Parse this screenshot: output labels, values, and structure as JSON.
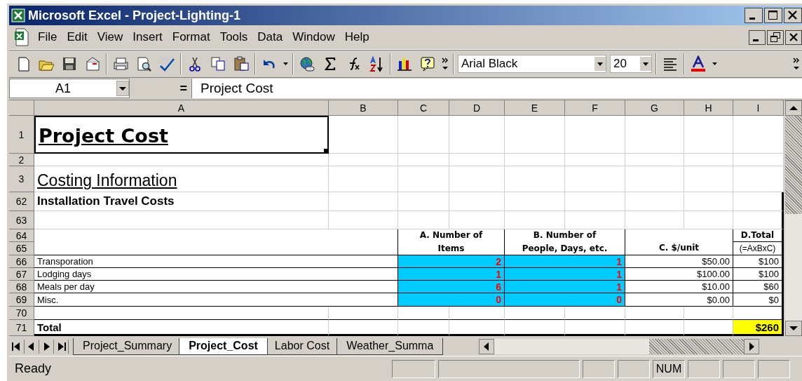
{
  "window": {
    "title": "Microsoft Excel - Project-Lighting-1"
  },
  "menu": [
    "File",
    "Edit",
    "View",
    "Insert",
    "Format",
    "Tools",
    "Data",
    "Window",
    "Help"
  ],
  "toolbar": {
    "font": "Arial Black",
    "font_size": "20"
  },
  "formula_bar": {
    "name_box": "A1",
    "equals": "=",
    "content": "Project Cost"
  },
  "sheet": {
    "columns": [
      "A",
      "B",
      "C",
      "D",
      "E",
      "F",
      "G",
      "H",
      "I"
    ],
    "rows": [
      {
        "header": "1",
        "kind": "title",
        "text": "Project Cost",
        "selected": true
      },
      {
        "header": "2",
        "kind": "blank"
      },
      {
        "header": "3",
        "kind": "heading",
        "text": "Costing Information"
      },
      {
        "header": "62",
        "kind": "section",
        "text": "Installation Travel Costs"
      },
      {
        "header": "63",
        "kind": "blank"
      },
      {
        "headers": [
          "64",
          "65"
        ],
        "kind": "head",
        "items": "A. Number of\nItems",
        "people": "B. Number of\nPeople, Days, etc.",
        "unit": "C. $/unit",
        "total": "D.Total",
        "formula": "(=AxBxC)"
      },
      {
        "header": "66",
        "kind": "item",
        "label": "Transporation",
        "items": "2",
        "people": "1",
        "unit": "$50.00",
        "total": "$100"
      },
      {
        "header": "67",
        "kind": "item",
        "label": "Lodging days",
        "items": "1",
        "people": "1",
        "unit": "$100.00",
        "total": "$100"
      },
      {
        "header": "68",
        "kind": "item",
        "label": "Meals per day",
        "items": "6",
        "people": "1",
        "unit": "$10.00",
        "total": "$60"
      },
      {
        "header": "69",
        "kind": "item",
        "label": "Misc.",
        "items": "0",
        "people": "0",
        "unit": "$0.00",
        "total": "$0"
      },
      {
        "header": "70",
        "kind": "blank"
      },
      {
        "header": "71",
        "kind": "total",
        "label": "Total",
        "total": "$260"
      }
    ]
  },
  "sheet_tabs": [
    {
      "label": "Project_Summary",
      "selected": false
    },
    {
      "label": "Project_Cost",
      "selected": true
    },
    {
      "label": "Labor Cost",
      "selected": false
    },
    {
      "label": "Weather_Summa",
      "selected": false
    }
  ],
  "status_bar": {
    "text": "Ready",
    "indicators": [
      "NUM"
    ]
  }
}
